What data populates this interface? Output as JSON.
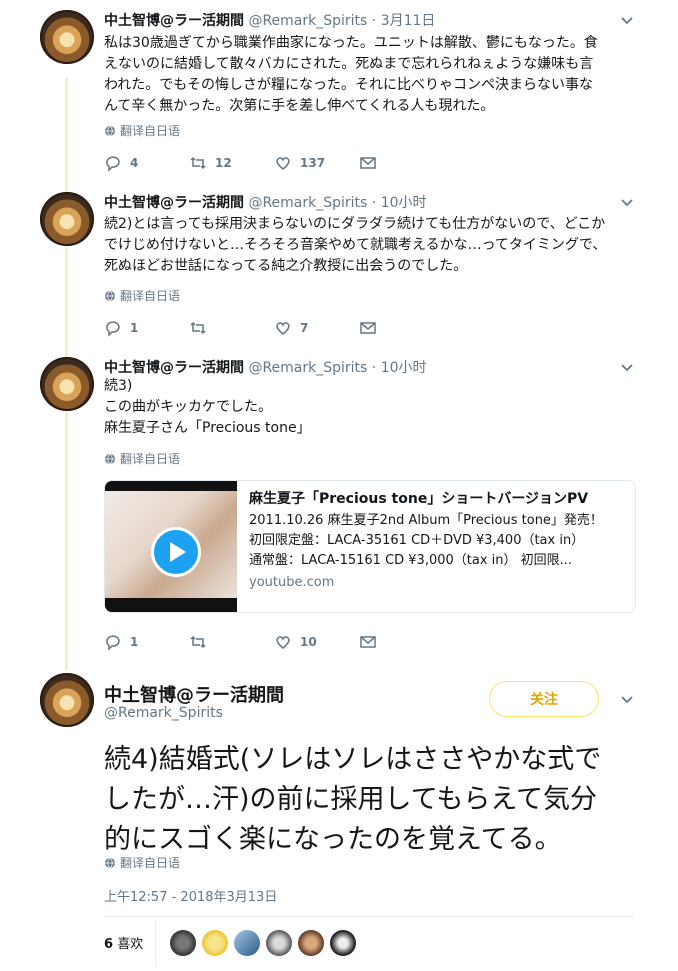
{
  "tweets": [
    {
      "name": "中土智博@ラー活期間",
      "handle": "@Remark_Spirits",
      "time": "· 3月11日",
      "lines": [
        "私は30歳過ぎてから職業作曲家になった。ユニットは解散、鬱にもなった。食",
        "えないのに結婚して散々バカにされた。死ぬまで忘れられねぇような嫌味も言",
        "われた。でもその悔しさが糧になった。それに比べりゃコンペ決まらない事な",
        "んて辛く無かった。次第に手を差し伸べてくれる人も現れた。"
      ],
      "translate": "翻译自日语",
      "reply": "4",
      "retweet": "12",
      "like": "137"
    },
    {
      "name": "中土智博@ラー活期間",
      "handle": "@Remark_Spirits",
      "time": "· 10小时",
      "lines": [
        "続2)とは言っても採用決まらないのにダラダラ続けても仕方がないので、どこか",
        "でけじめ付けないと…そろそろ音楽やめて就職考えるかな…ってタイミングで、",
        "死ぬほどお世話になってる純之介教授に出会うのでした。"
      ],
      "translate": "翻译自日语",
      "reply": "1",
      "retweet": "",
      "like": "7"
    },
    {
      "name": "中土智博@ラー活期間",
      "handle": "@Remark_Spirits",
      "time": "· 10小时",
      "lines": [
        "続3)",
        "この曲がキッカケでした。",
        "麻生夏子さん「Precious tone」"
      ],
      "translate": "翻译自日语",
      "card": {
        "title": "麻生夏子「Precious tone」ショートバージョンPV",
        "desc1": "2011.10.26 麻生夏子2nd Album「Precious tone」発売！",
        "desc2": "初回限定盤：LACA-35161 CD＋DVD ¥3,400（tax in）",
        "desc3": "通常盤：LACA-15161 CD ¥3,000（tax in） 初回限...",
        "domain": "youtube.com"
      },
      "reply": "1",
      "retweet": "",
      "like": "10"
    }
  ],
  "main": {
    "name": "中土智博@ラー活期間",
    "handle": "@Remark_Spirits",
    "follow": "关注",
    "lines": [
      "続4)結婚式(ソレはソレはささやかな式で",
      "したが…汗)の前に採用してもらえて気分",
      "的にスゴく楽になったのを覚えてる。"
    ],
    "translate": "翻译自日语",
    "timestamp": "上午12:57 - 2018年3月13日",
    "likes_count": "6",
    "likes_label": "喜欢"
  },
  "colors": {
    "accent": "#1da1f2",
    "follow": "#e0a800",
    "thread": "#f5f0c8"
  }
}
